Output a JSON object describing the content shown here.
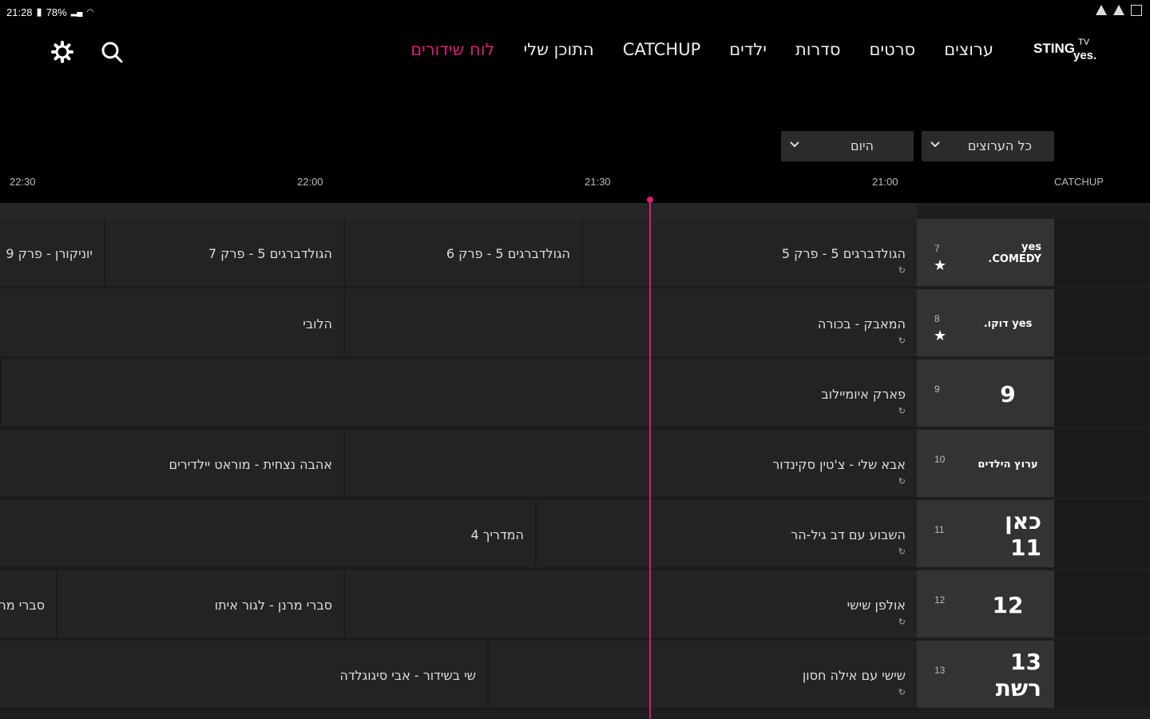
{
  "status": {
    "time": "21:28",
    "battery": "78%"
  },
  "nav": {
    "items": [
      "ערוצים",
      "סרטים",
      "סדרות",
      "ילדים",
      "CATCHUP",
      "התוכן שלי",
      "לוח שידורים"
    ],
    "active_index": 6,
    "accent_color": "#e0197d"
  },
  "logo": {
    "text": "STINGTV",
    "sub": "yes"
  },
  "filters": {
    "channels": "כל הערוצים",
    "day": "היום"
  },
  "time_header": {
    "catchup": "CATCHUP",
    "times": [
      "21:00",
      "21:30",
      "22:00",
      "22:30"
    ]
  },
  "channels": [
    {
      "num": "7",
      "logo": "yes COMEDY.",
      "fav": true,
      "programs": [
        "הגולדברגים 5 - פרק 5",
        "הגולדברגים 5 - פרק 6",
        "הגולדברגים 5 - פרק 7",
        "יוניקורן - פרק 9"
      ]
    },
    {
      "num": "8",
      "logo": "yes דוקו.",
      "fav": true,
      "programs": [
        "המאבק - בכורה",
        "הלובי"
      ]
    },
    {
      "num": "9",
      "logo": "9",
      "fav": false,
      "programs": [
        "פארק איומיילוב"
      ]
    },
    {
      "num": "10",
      "logo": "ערוץ הילדים",
      "fav": false,
      "programs": [
        "אבא שלי - צ'טין סקינדור",
        "אהבה נצחית - מוראט יילדירים"
      ]
    },
    {
      "num": "11",
      "logo": "כאן 11",
      "fav": false,
      "programs": [
        "השבוע עם דב גיל-הר",
        "המדריך 4"
      ]
    },
    {
      "num": "12",
      "logo": "12",
      "fav": false,
      "programs": [
        "אולפן שישי",
        "סברי מרנן - לגור איתו",
        "סברי מרנן"
      ]
    },
    {
      "num": "13",
      "logo": "13 רשת",
      "fav": false,
      "programs": [
        "שישי עם אילה חסון",
        "שי בשידור - אבי סיגוגלדה"
      ]
    }
  ],
  "replay_glyph": "↻",
  "star_glyph": "★"
}
